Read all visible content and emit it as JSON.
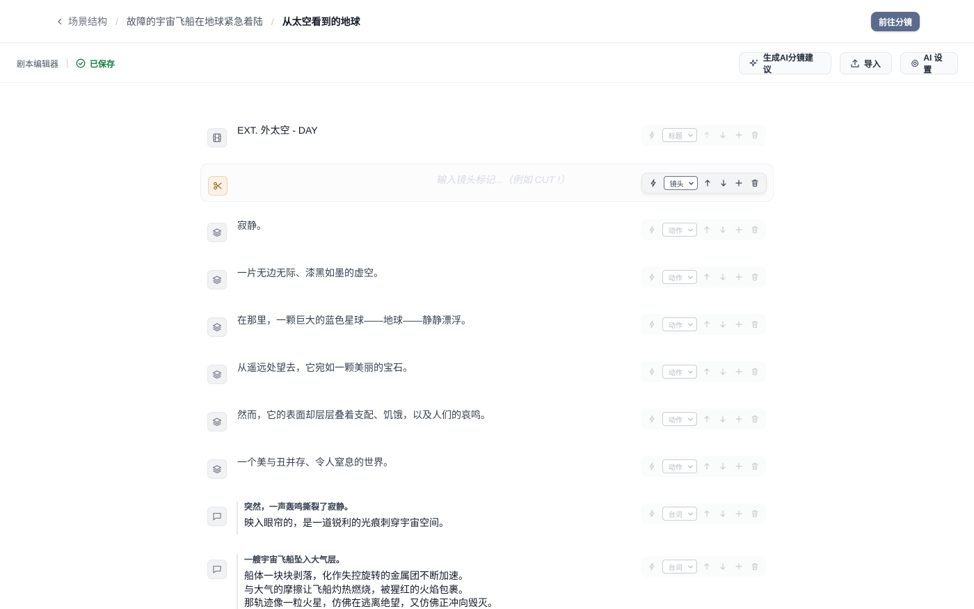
{
  "breadcrumb": {
    "back_label": "场景结构",
    "parent": "故障的宇宙飞船在地球紧急着陆",
    "current": "从太空看到的地球"
  },
  "goto_button": "前往分镜",
  "toolbar": {
    "editor_label": "剧本编辑器",
    "saved_label": "已保存",
    "ai_suggest_label": "生成AI分镜建议",
    "import_label": "导入",
    "ai_settings_label": "AI 设置"
  },
  "rows": [
    {
      "type_label": "标题",
      "text": "EXT. 外太空 - DAY"
    },
    {
      "type_label": "镜头",
      "placeholder": "输入镜头标记...（例如 CUT !）"
    },
    {
      "type_label": "动作",
      "text": "寂静。"
    },
    {
      "type_label": "动作",
      "text": "一片无边无际、漆黑如墨的虚空。"
    },
    {
      "type_label": "动作",
      "text": "在那里，一颗巨大的蓝色星球——地球——静静漂浮。"
    },
    {
      "type_label": "动作",
      "text": "从遥远处望去，它宛如一颗美丽的宝石。"
    },
    {
      "type_label": "动作",
      "text": "然而，它的表面却层层叠着支配、饥饿，以及人们的哀鸣。"
    },
    {
      "type_label": "动作",
      "text": "一个美与丑并存、令人窒息的世界。"
    },
    {
      "type_label": "台词",
      "character": "突然，一声轰鸣撕裂了寂静。",
      "lines": [
        "映入眼帘的，是一道锐利的光痕刺穿宇宙空间。"
      ]
    },
    {
      "type_label": "台词",
      "character": "一艘宇宙飞船坠入大气层。",
      "lines": [
        "船体一块块剥落，化作失控旋转的金属团不断加速。",
        "与大气的摩擦让飞船灼热燃烧，被猩红的火焰包裹。",
        "那轨迹像一粒火星，仿佛在逃离绝望，又仿佛正冲向毁灭。"
      ]
    }
  ]
}
